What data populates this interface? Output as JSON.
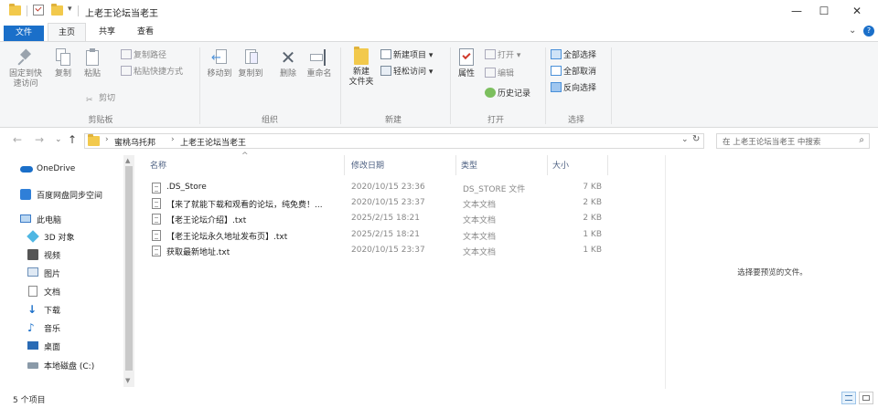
{
  "window": {
    "title": "上老王论坛当老王",
    "qa_pin": "▾",
    "controls": {
      "minimize": "—",
      "maximize": "☐",
      "close": "✕"
    }
  },
  "ribbon_tabs": [
    "文件",
    "主页",
    "共享",
    "查看"
  ],
  "ribbon_controls": {
    "collapse": "⌄",
    "help": "?"
  },
  "ribbon": {
    "clipboard": {
      "pin": "固定到快\n速访问",
      "copy": "复制",
      "paste": "粘贴",
      "copy_path": "复制路径",
      "paste_shortcut": "粘贴快捷方式",
      "cut": "剪切",
      "label": "剪贴板"
    },
    "organize": {
      "move_to": "移动到",
      "copy_to": "复制到",
      "delete": "删除",
      "rename": "重命名",
      "label": "组织"
    },
    "new": {
      "new_folder": "新建\n文件夹",
      "new_item": "新建项目 ▾",
      "easy_access": "轻松访问 ▾",
      "label": "新建"
    },
    "open": {
      "properties": "属性",
      "open": "打开 ▾",
      "edit": "编辑",
      "history": "历史记录",
      "label": "打开"
    },
    "select": {
      "select_all": "全部选择",
      "select_none": "全部取消",
      "invert": "反向选择",
      "label": "选择"
    }
  },
  "address": {
    "crumbs": [
      "蜜桃乌托邦",
      "上老王论坛当老王"
    ],
    "separator": "›",
    "dropdown": "⌄",
    "refresh": "↻",
    "search_placeholder": "在 上老王论坛当老王 中搜索",
    "nav": {
      "back": "←",
      "forward": "→",
      "recent": "⌄",
      "up": "↑"
    }
  },
  "sidebar": {
    "items": [
      {
        "label": "OneDrive",
        "icon": "onedrive-icon"
      },
      {
        "label": "百度网盘同步空间",
        "icon": "baidu-netdisk-icon"
      },
      {
        "label": "此电脑",
        "icon": "computer-icon"
      },
      {
        "label": "3D 对象",
        "icon": "3d-objects-icon"
      },
      {
        "label": "视频",
        "icon": "video-icon"
      },
      {
        "label": "图片",
        "icon": "pictures-icon"
      },
      {
        "label": "文档",
        "icon": "documents-icon"
      },
      {
        "label": "下载",
        "icon": "download-icon"
      },
      {
        "label": "音乐",
        "icon": "music-icon"
      },
      {
        "label": "桌面",
        "icon": "desktop-icon"
      },
      {
        "label": "本地磁盘 (C:)",
        "icon": "drive-icon"
      }
    ],
    "scroll_up": "▲",
    "scroll_down": "▼"
  },
  "files": {
    "sort_indicator": "^",
    "columns": {
      "name": "名称",
      "date": "修改日期",
      "type": "类型",
      "size": "大小"
    },
    "rows": [
      {
        "name": ".DS_Store",
        "date": "2020/10/15 23:36",
        "type": "DS_STORE 文件",
        "size": "7 KB"
      },
      {
        "name": "【来了就能下载和观看的论坛，纯免费！...",
        "date": "2020/10/15 23:37",
        "type": "文本文档",
        "size": "2 KB"
      },
      {
        "name": "【老王论坛介绍】.txt",
        "date": "2025/2/15 18:21",
        "type": "文本文档",
        "size": "2 KB"
      },
      {
        "name": "【老王论坛永久地址发布页】.txt",
        "date": "2025/2/15 18:21",
        "type": "文本文档",
        "size": "1 KB"
      },
      {
        "name": "获取最新地址.txt",
        "date": "2020/10/15 23:37",
        "type": "文本文档",
        "size": "1 KB"
      }
    ]
  },
  "preview": {
    "message": "选择要预览的文件。"
  },
  "status": {
    "item_count": "5 个项目"
  },
  "colors": {
    "accent": "#1a6fc9",
    "folder": "#f2c94c",
    "header_text": "#4d6082"
  }
}
